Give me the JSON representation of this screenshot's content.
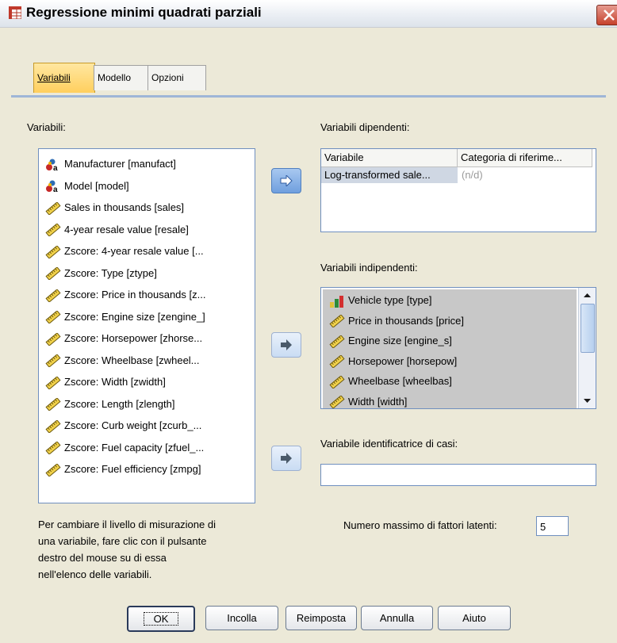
{
  "window": {
    "title": "Regressione minimi quadrati parziali",
    "close_glyph": "X"
  },
  "tabs": [
    {
      "label": "Variabili"
    },
    {
      "label": "Modello"
    },
    {
      "label": "Opzioni"
    }
  ],
  "variables_panel": {
    "label": "Variabili:",
    "items": [
      {
        "label": "Manufacturer [manufact]",
        "icon": "nominal-string-icon"
      },
      {
        "label": "Model [model]",
        "icon": "nominal-string-icon"
      },
      {
        "label": "Sales in thousands [sales]",
        "icon": "scale-ruler-icon"
      },
      {
        "label": "4-year resale value [resale]",
        "icon": "scale-ruler-icon"
      },
      {
        "label": "Zscore:  4-year resale value [...",
        "icon": "scale-ruler-icon"
      },
      {
        "label": "Zscore:  Type [ztype]",
        "icon": "scale-ruler-icon"
      },
      {
        "label": "Zscore:  Price in thousands [z...",
        "icon": "scale-ruler-icon"
      },
      {
        "label": "Zscore:  Engine size [zengine_]",
        "icon": "scale-ruler-icon"
      },
      {
        "label": "Zscore:  Horsepower [zhorse...",
        "icon": "scale-ruler-icon"
      },
      {
        "label": "Zscore:  Wheelbase [zwheel...",
        "icon": "scale-ruler-icon"
      },
      {
        "label": "Zscore:  Width [zwidth]",
        "icon": "scale-ruler-icon"
      },
      {
        "label": "Zscore:  Length [zlength]",
        "icon": "scale-ruler-icon"
      },
      {
        "label": "Zscore:  Curb weight [zcurb_...",
        "icon": "scale-ruler-icon"
      },
      {
        "label": "Zscore:  Fuel capacity [zfuel_...",
        "icon": "scale-ruler-icon"
      },
      {
        "label": "Zscore:  Fuel efficiency [zmpg]",
        "icon": "scale-ruler-icon"
      }
    ],
    "hint": [
      "Per cambiare il livello di misurazione di",
      "una variabile, fare clic con il pulsante",
      "destro del mouse su di essa",
      "nell'elenco delle variabili."
    ]
  },
  "dependent": {
    "label": "Variabili dipendenti:",
    "columns": [
      "Variabile",
      "Categoria di riferime..."
    ],
    "rows": [
      [
        "Log-transformed sale...",
        "(n/d)"
      ]
    ]
  },
  "independent": {
    "label": "Variabili indipendenti:",
    "items": [
      {
        "label": "Vehicle type [type]",
        "icon": "bar-chart-icon"
      },
      {
        "label": "Price in thousands [price]",
        "icon": "scale-ruler-icon"
      },
      {
        "label": "Engine size [engine_s]",
        "icon": "scale-ruler-icon"
      },
      {
        "label": "Horsepower [horsepow]",
        "icon": "scale-ruler-icon"
      },
      {
        "label": "Wheelbase [wheelbas]",
        "icon": "scale-ruler-icon"
      },
      {
        "label": "Width [width]",
        "icon": "scale-ruler-icon"
      }
    ]
  },
  "case_id": {
    "label": "Variabile identificatrice di casi:",
    "value": ""
  },
  "latent": {
    "label": "Numero massimo di fattori latenti:",
    "value": "5"
  },
  "buttons": {
    "ok": "OK",
    "paste": "Incolla",
    "reset": "Reimposta",
    "cancel": "Annulla",
    "help": "Aiuto"
  },
  "colors": {
    "active_tab": "#ffcf5e",
    "list_selection": "#c8c8c8",
    "accent": "#6f9fde"
  }
}
